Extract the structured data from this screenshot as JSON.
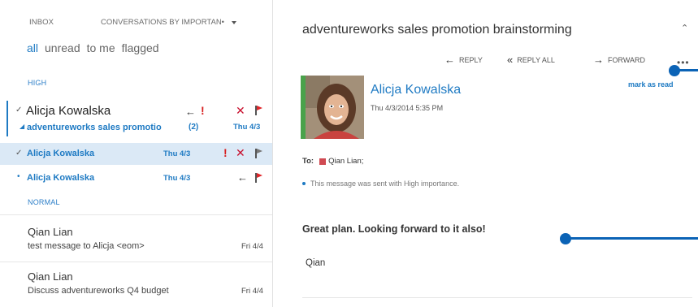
{
  "header": {
    "folder": "INBOX",
    "sort_label": "CONVERSATIONS BY IMPORTAN•"
  },
  "filters": [
    "all",
    "unread",
    "to me",
    "flagged"
  ],
  "sections": {
    "high": "HIGH",
    "normal": "NORMAL"
  },
  "conversation": {
    "sender": "Alicja Kowalska",
    "subject": "adventureworks sales promotio",
    "count": "(2)",
    "date": "Thu 4/3"
  },
  "thread_items": [
    {
      "sender": "Alicja Kowalska",
      "date": "Thu 4/3"
    },
    {
      "sender": "Alicja Kowalska",
      "date": "Thu 4/3"
    }
  ],
  "normal_items": [
    {
      "sender": "Qian Lian",
      "subject": "test message to Alicja <eom>",
      "date": "Fri 4/4"
    },
    {
      "sender": "Qian Lian",
      "subject": "Discuss adventureworks Q4 budget",
      "date": "Fri 4/4"
    }
  ],
  "reading": {
    "title": "adventureworks sales promotion brainstorming",
    "actions": {
      "reply": "REPLY",
      "reply_all": "REPLY ALL",
      "forward": "FORWARD"
    },
    "more": "•••",
    "mark_as_read": "mark as read",
    "from_name": "Alicja Kowalska",
    "from_date": "Thu 4/3/2014 5:35 PM",
    "to_label": "To:",
    "to_recipient": "Qian Lian;",
    "importance_note": "This message was sent with High importance.",
    "body": "Great plan. Looking forward to it also!",
    "signature": "Qian"
  },
  "colors": {
    "accent": "#1e7ac3",
    "selected_bg": "#dbe9f6",
    "importance_red": "#d71f1f",
    "flag_red": "#e0262a",
    "avatar_green": "#4aa24b",
    "callout_blue": "#0b63b6"
  },
  "icons": [
    "reply-icon",
    "reply-all-icon",
    "forward-icon",
    "importance-icon",
    "delete-icon",
    "flag-icon",
    "collapse-icon",
    "more-icon",
    "check-icon",
    "caret-down-icon"
  ]
}
